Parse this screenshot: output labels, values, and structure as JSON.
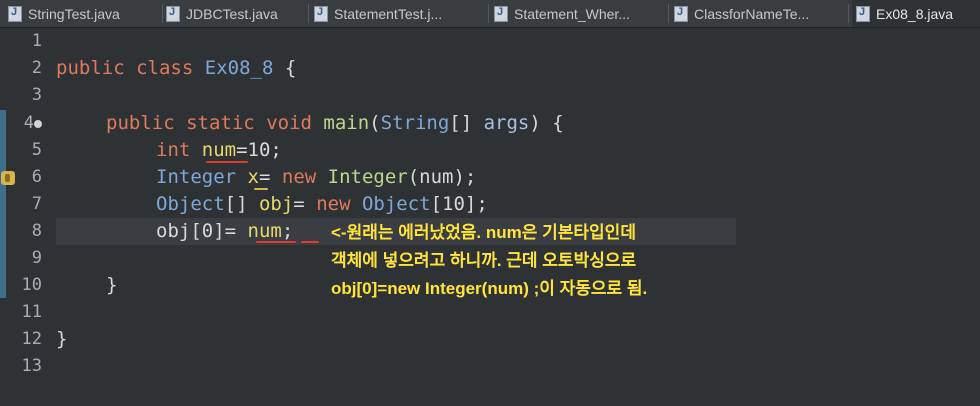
{
  "tabs": [
    {
      "label": "StringTest.java",
      "active": false
    },
    {
      "label": "JDBCTest.java",
      "active": false
    },
    {
      "label": "StatementTest.j...",
      "active": false
    },
    {
      "label": "Statement_Wher...",
      "active": false
    },
    {
      "label": "ClassforNameTe...",
      "active": false
    },
    {
      "label": "Ex08_8.java",
      "active": true
    }
  ],
  "editor": {
    "line_numbers": [
      "1",
      "2",
      "3",
      "4",
      "5",
      "6",
      "7",
      "8",
      "9",
      "10",
      "11",
      "12",
      "13"
    ],
    "code": {
      "l2": {
        "kw1": "public",
        "kw2": "class",
        "name": "Ex08_8",
        "rest": " {"
      },
      "l4": {
        "kw1": "public",
        "kw2": "static",
        "kw3": "void",
        "method": "main",
        "p1": "(",
        "type": "String",
        "p2": "[] ",
        "arg": "args",
        "p3": ") {"
      },
      "l5": {
        "kw": "int",
        "var": "num",
        "rest": "=10;"
      },
      "l6": {
        "type": "Integer",
        "var": "x",
        "eq": "= ",
        "kw": "new",
        "type2": "Integer",
        "rest": "(num);"
      },
      "l7": {
        "type": "Object",
        "p1": "[] ",
        "var": "obj",
        "eq": "= ",
        "kw": "new",
        "type2": "Object",
        "rest": "[10];"
      },
      "l8": {
        "lhs": "obj[0]= ",
        "var": "num",
        "rest": ";"
      },
      "l10": {
        "text": "}"
      },
      "l12": {
        "text": "}"
      }
    }
  },
  "annotation": {
    "color": "#ffe53b",
    "lines": [
      "<-원래는 에러났었음. num은 기본타입인데",
      "객체에 넣으려고 하니까. 근데 오토박싱으로",
      "obj[0]=new Integer(num) ;이 자동으로 됨."
    ]
  },
  "colors": {
    "background": "#2f3235",
    "keyword": "#e0795c",
    "type": "#7fa7d8",
    "method": "#b9d98d",
    "squiggle": "#e23b2e"
  }
}
